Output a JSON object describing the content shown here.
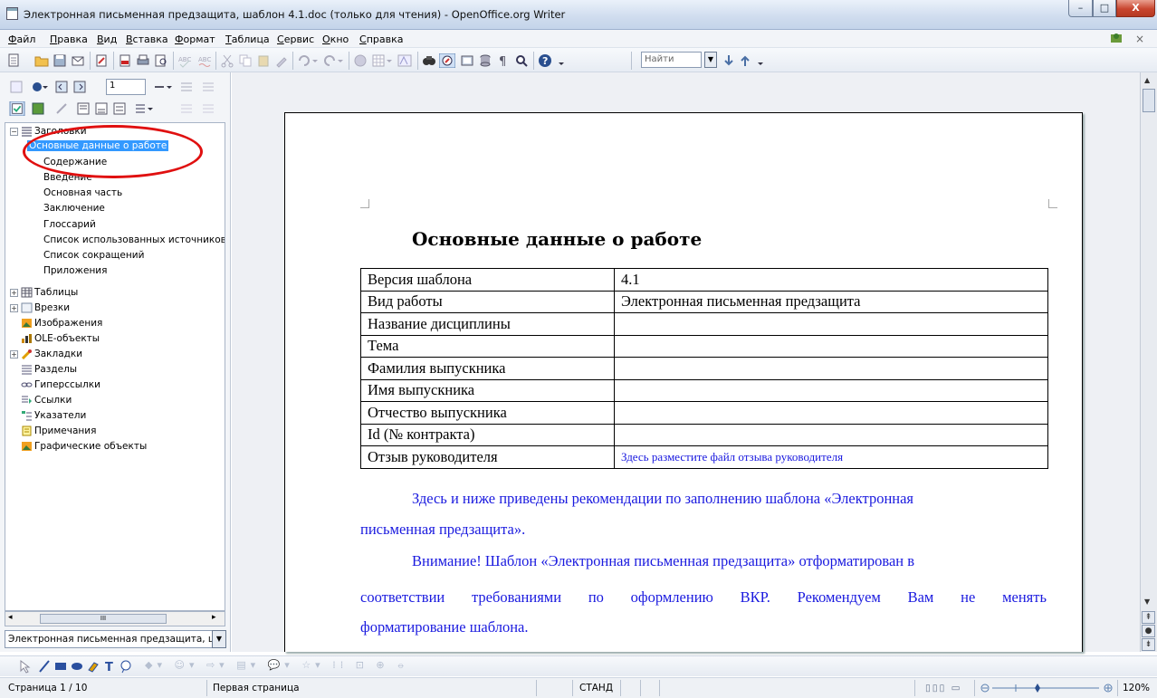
{
  "window": {
    "title": "Электронная письменная предзащита, шаблон 4.1.doc (только для чтения) - OpenOffice.org Writer",
    "min_label": "–",
    "max_label": "□",
    "close_label": "X"
  },
  "menu": {
    "items": [
      "Файл",
      "Правка",
      "Вид",
      "Вставка",
      "Формат",
      "Таблица",
      "Сервис",
      "Окно",
      "Справка"
    ],
    "close_doc": "×"
  },
  "toolbar": {
    "find_placeholder": "Найти"
  },
  "navigator": {
    "page_number": "1",
    "tree": {
      "headings": {
        "label": "Заголовки",
        "items": [
          "Основные данные о работе",
          "Содержание",
          "Введение",
          "Основная часть",
          "Заключение",
          "Глоссарий",
          "Список использованных источников",
          "Список сокращений",
          "Приложения"
        ]
      },
      "categories": [
        {
          "label": "Таблицы",
          "icon": "table-icon",
          "expandable": true
        },
        {
          "label": "Врезки",
          "icon": "frame-icon",
          "expandable": true
        },
        {
          "label": "Изображения",
          "icon": "image-icon",
          "expandable": false
        },
        {
          "label": "OLE-объекты",
          "icon": "ole-icon",
          "expandable": false
        },
        {
          "label": "Закладки",
          "icon": "bookmark-icon",
          "expandable": true
        },
        {
          "label": "Разделы",
          "icon": "section-icon",
          "expandable": false
        },
        {
          "label": "Гиперссылки",
          "icon": "hyperlink-icon",
          "expandable": false
        },
        {
          "label": "Ссылки",
          "icon": "reference-icon",
          "expandable": false
        },
        {
          "label": "Указатели",
          "icon": "index-icon",
          "expandable": false
        },
        {
          "label": "Примечания",
          "icon": "note-icon",
          "expandable": false
        },
        {
          "label": "Графические объекты",
          "icon": "drawing-icon",
          "expandable": false
        }
      ]
    },
    "scroll_thumb_label": "III",
    "document_combo": "Электронная письменная предзащита, ш"
  },
  "document": {
    "title": "Основные данные о работе",
    "table": [
      {
        "key": "Версия шаблона",
        "value": "4.1",
        "blue": false
      },
      {
        "key": "Вид работы",
        "value": "Электронная письменная предзащита",
        "blue": false
      },
      {
        "key": "Название дисциплины",
        "value": "",
        "blue": false
      },
      {
        "key": "Тема",
        "value": "",
        "blue": false
      },
      {
        "key": "Фамилия выпускника",
        "value": "",
        "blue": false
      },
      {
        "key": "Имя выпускника",
        "value": "",
        "blue": false
      },
      {
        "key": "Отчество выпускника",
        "value": "",
        "blue": false
      },
      {
        "key": "Id (№ контракта)",
        "value": "",
        "blue": false
      },
      {
        "key": "Отзыв руководителя",
        "value": "Здесь разместите файл отзыва руководителя",
        "blue": true
      }
    ],
    "paragraphs": [
      "Здесь и ниже приведены рекомендации по заполнению шаблона «Электронная",
      "письменная предзащита».",
      "Внимание! Шаблон «Электронная письменная предзащита» отформатирован в",
      "соответствии  требованиями по оформлению ВКР. Рекомендуем Вам не менять",
      "форматирование шаблона."
    ]
  },
  "statusbar": {
    "page": "Страница  1 / 10",
    "page_style": "Первая страница",
    "mode": "СТАНД",
    "zoom": "120%"
  },
  "colors": {
    "highlight": "#3399ff",
    "annotation_red": "#e01010",
    "hint_blue": "#1a1adf"
  }
}
